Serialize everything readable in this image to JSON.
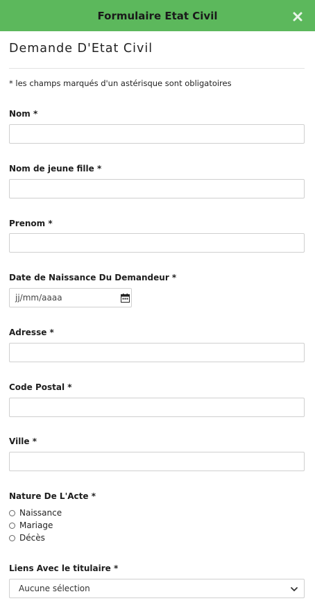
{
  "header": {
    "title": "Formulaire Etat Civil",
    "close_icon": "close-icon"
  },
  "form": {
    "title": "Demande D'Etat Civil",
    "required_note": "* les champs marqués d'un astérisque sont obligatoires",
    "fields": {
      "nom": {
        "label": "Nom *",
        "value": ""
      },
      "nom_jeune_fille": {
        "label": "Nom de jeune fille *",
        "value": ""
      },
      "prenom": {
        "label": "Prenom *",
        "value": ""
      },
      "date_naissance": {
        "label": "Date de Naissance Du Demandeur *",
        "placeholder": "jj/mm/aaaa",
        "icon": "calendar-icon"
      },
      "adresse": {
        "label": "Adresse *",
        "value": ""
      },
      "code_postal": {
        "label": "Code Postal *",
        "value": ""
      },
      "ville": {
        "label": "Ville *",
        "value": ""
      }
    },
    "nature_acte": {
      "label": "Nature De L'Acte *",
      "options": [
        "Naissance",
        "Mariage",
        "Décès"
      ]
    },
    "liens_titulaire": {
      "label": "Liens Avec le titulaire *",
      "selected": "Aucune sélection",
      "icon": "chevron-down-icon"
    }
  },
  "colors": {
    "header_bg": "#5cb85c",
    "input_border": "#cfcfcf"
  }
}
